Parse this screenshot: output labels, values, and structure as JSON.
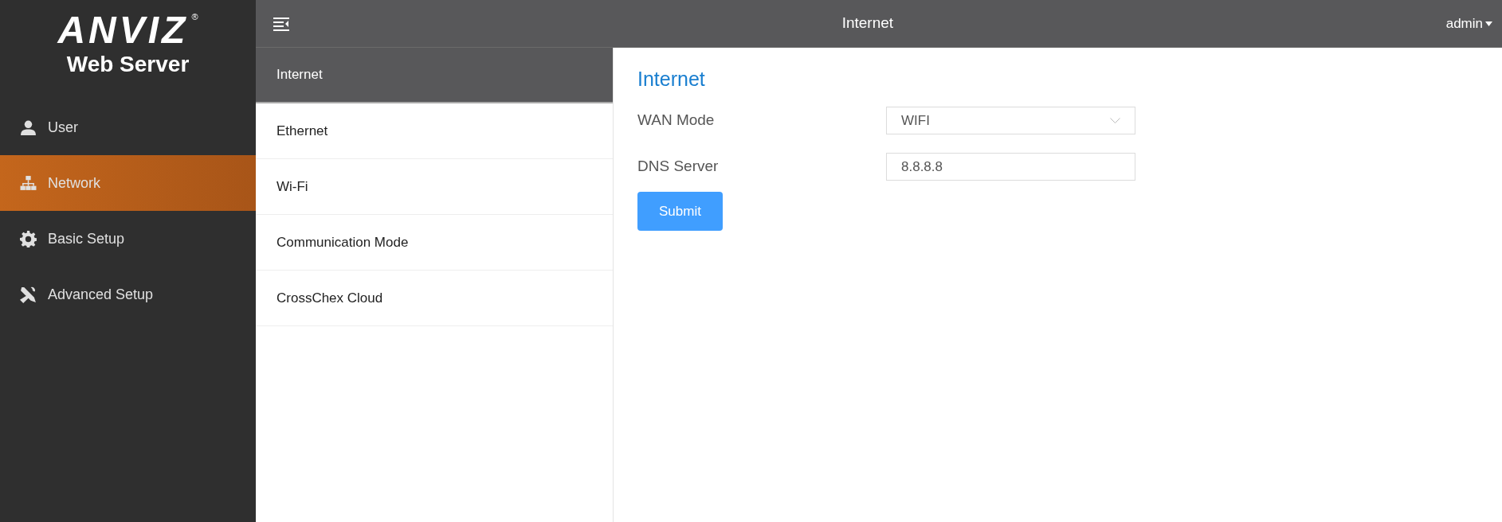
{
  "logo": {
    "wordmark": "ANVIZ",
    "mark": "®",
    "subtitle": "Web Server"
  },
  "sidebar": {
    "items": [
      {
        "label": "User",
        "kind": "user",
        "selected": false
      },
      {
        "label": "Network",
        "kind": "network",
        "selected": true
      },
      {
        "label": "Basic Setup",
        "kind": "gear",
        "selected": false
      },
      {
        "label": "Advanced Setup",
        "kind": "tools",
        "selected": false
      }
    ]
  },
  "header": {
    "title": "Internet",
    "user": "admin"
  },
  "submenu": {
    "items": [
      {
        "label": "Internet",
        "selected": true
      },
      {
        "label": "Ethernet",
        "selected": false
      },
      {
        "label": "Wi-Fi",
        "selected": false
      },
      {
        "label": "Communication Mode",
        "selected": false
      },
      {
        "label": "CrossChex Cloud",
        "selected": false
      }
    ]
  },
  "form": {
    "title": "Internet",
    "fields": [
      {
        "kind": "select",
        "label": "WAN Mode",
        "value": "WIFI"
      },
      {
        "kind": "text",
        "label": "DNS Server",
        "value": "8.8.8.8"
      }
    ],
    "submit": "Submit"
  }
}
